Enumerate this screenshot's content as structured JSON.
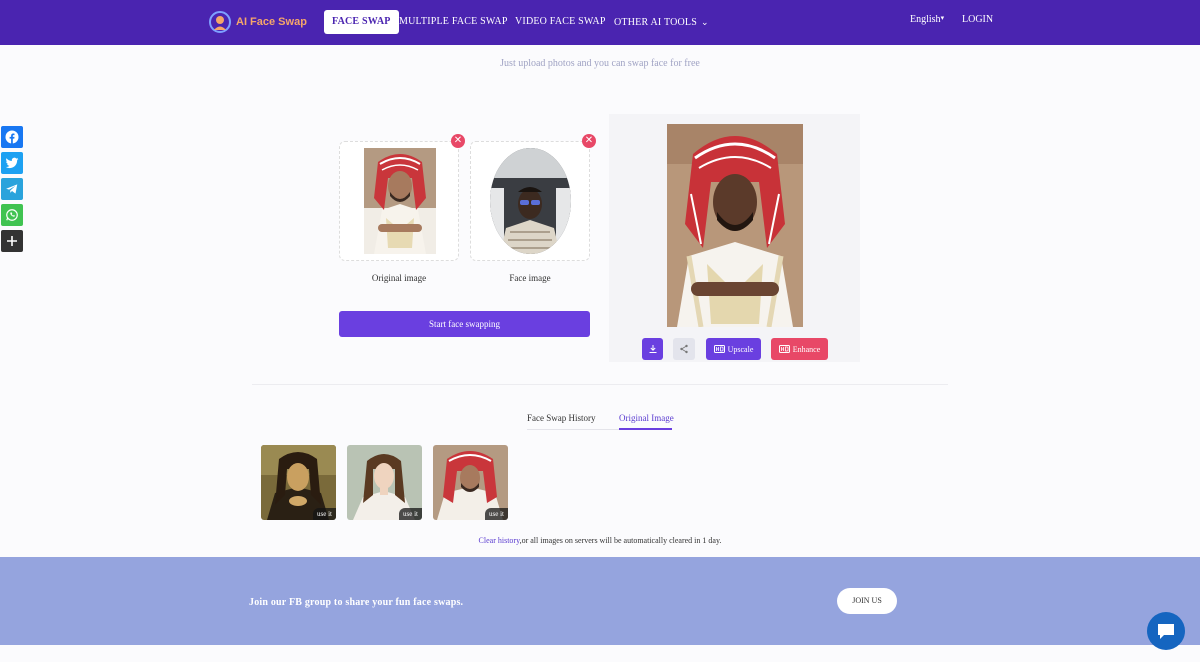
{
  "nav": {
    "logo_text": "AI Face Swap",
    "items": [
      {
        "label": "FACE SWAP",
        "active": true
      },
      {
        "label": "MULTIPLE FACE SWAP"
      },
      {
        "label": "VIDEO FACE SWAP"
      },
      {
        "label": "OTHER AI TOOLS",
        "has_dropdown": true
      }
    ],
    "language": "English",
    "login": "LOGIN"
  },
  "subtitle": "Just upload photos and you can swap face for free",
  "social": [
    "facebook-icon",
    "twitter-icon",
    "telegram-icon",
    "whatsapp-icon",
    "plus-icon"
  ],
  "upload": {
    "original_label": "Original image",
    "face_label": "Face image",
    "start_button": "Start face swapping"
  },
  "result": {
    "upscale_label": "Upscale",
    "enhance_label": "Enhance"
  },
  "tabs": [
    {
      "label": "Face Swap History"
    },
    {
      "label": "Original Image",
      "active": true
    }
  ],
  "thumbs": [
    {
      "name": "mona-lisa",
      "action": "use it"
    },
    {
      "name": "woman-portrait",
      "action": "use it"
    },
    {
      "name": "man-keffiyeh",
      "action": "use it"
    }
  ],
  "clear_note": {
    "link": "Clear history",
    "text": ",or all images on servers will be automatically cleared in 1 day."
  },
  "banner": {
    "text": "Join our FB group to share your fun face swaps.",
    "button": "JOIN US"
  },
  "colors": {
    "nav_bg": "#4a24b0",
    "accent": "#6a3fe0",
    "enhance": "#e84867",
    "banner_bg": "#95a4de"
  }
}
